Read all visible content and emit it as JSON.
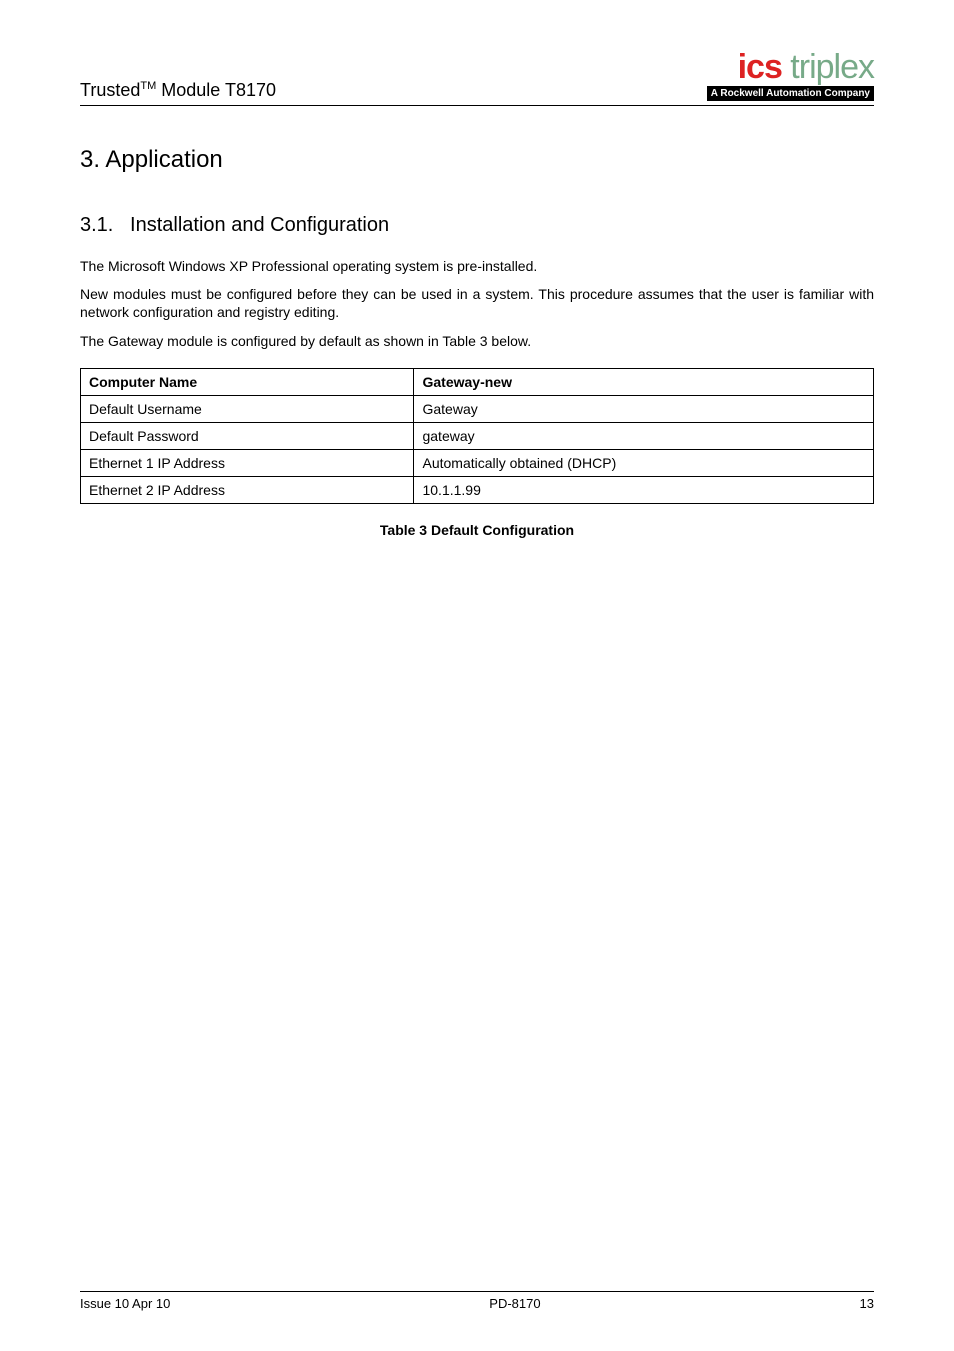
{
  "header": {
    "left_product": "Trusted",
    "left_tm": "TM",
    "left_module": "  Module T8170",
    "logo_ics": "ics",
    "logo_triplex": " triplex",
    "logo_bar_prefix": "A ",
    "logo_bar_brand": "Rockwell Automation",
    "logo_bar_suffix": " Company"
  },
  "section": {
    "num": "3.",
    "title": "Application"
  },
  "subsection": {
    "num": "3.1.",
    "title": "Installation and Configuration"
  },
  "paras": {
    "p1": "The Microsoft Windows XP Professional operating system is pre-installed.",
    "p2": "New modules must be configured before they can be used in a system.  This procedure assumes that the user is familiar with network configuration and registry editing.",
    "p3": "The Gateway module is configured by default as shown in Table 3 below."
  },
  "table": {
    "header": {
      "c1": "Computer Name",
      "c2": "Gateway-new"
    },
    "rows": [
      {
        "c1": "Default Username",
        "c2": "Gateway"
      },
      {
        "c1": "Default Password",
        "c2": "gateway"
      },
      {
        "c1": "Ethernet 1 IP Address",
        "c2": "Automatically obtained (DHCP)"
      },
      {
        "c1": "Ethernet 2 IP Address",
        "c2": "10.1.1.99"
      }
    ],
    "caption": "Table 3 Default Configuration"
  },
  "footer": {
    "left": "Issue 10 Apr 10",
    "center": "PD-8170",
    "right": "13"
  }
}
